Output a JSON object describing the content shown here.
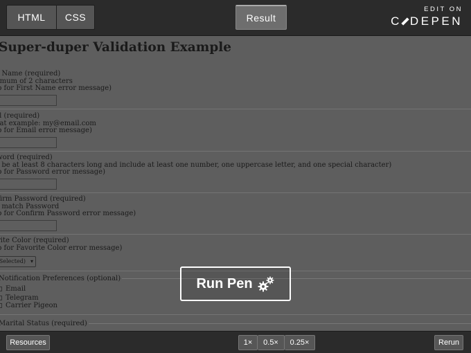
{
  "topbar": {
    "tabs": [
      {
        "label": "HTML"
      },
      {
        "label": "CSS"
      },
      {
        "label": "Result"
      }
    ],
    "brand": {
      "edit_on": "EDIT ON",
      "logo_left": "C",
      "logo_right": "DEPEN"
    }
  },
  "preview": {
    "title": "Super-duper Validation Example",
    "sections": [
      {
        "lines": [
          "st Name (required)",
          "nimum of 2 characters",
          "ab for First Name error message)"
        ]
      },
      {
        "lines": [
          "ail (required)",
          "mat example: my@email.com",
          "ab for Email error message)"
        ]
      },
      {
        "lines": [
          "sword (required)",
          "st be at least 8 characters long and include at least one number, one uppercase letter, and one special character)",
          "ab for Password error message)"
        ]
      },
      {
        "lines": [
          "nfirm Password (required)",
          "st match Password",
          "ab for Confirm Password error message)"
        ]
      },
      {
        "lines": [
          "orite Color (required)",
          "ab for Favorite Color error message)"
        ]
      }
    ],
    "select_value": "t Selected)",
    "notification_legend": "Notification Preferences (optional)",
    "checkboxes": [
      "Email",
      "Telegram",
      "Carrier Pigeon"
    ],
    "marital_legend": "Marital Status (required)"
  },
  "overlay": {
    "run_pen": "Run Pen"
  },
  "bottombar": {
    "resources": "Resources",
    "zoom": [
      "1×",
      "0.5×",
      "0.25×"
    ],
    "rerun": "Rerun"
  }
}
